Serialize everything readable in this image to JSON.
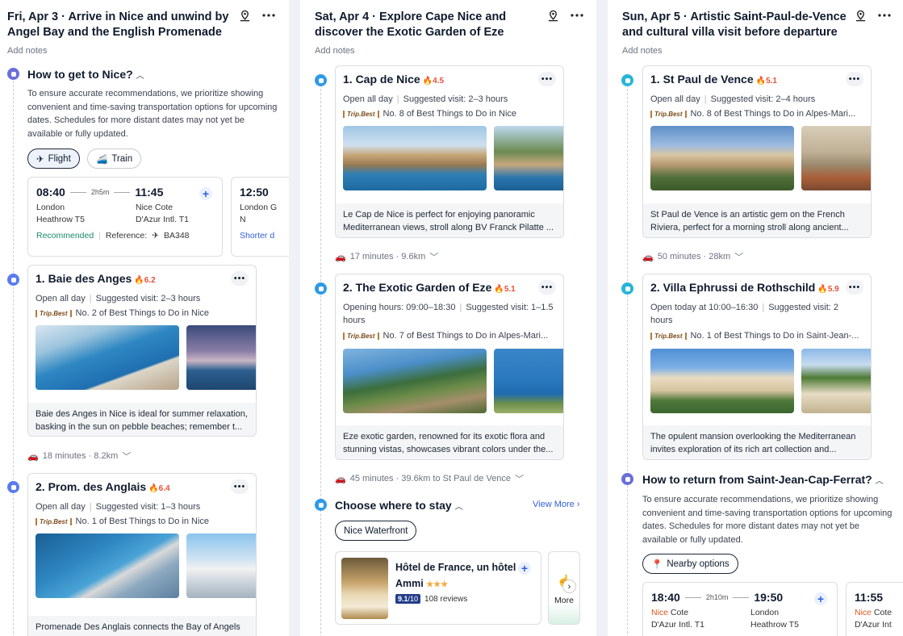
{
  "add_notes": "Add notes",
  "col1": {
    "title": "Fri, Apr 3 · Arrive in Nice and unwind by Angel Bay and the English Promenade",
    "transport": {
      "title": "How to get to Nice?",
      "description": "To ensure accurate recommendations, we prioritize showing convenient and time-saving transportation options for upcoming dates. Schedules for more distant dates may not yet be available or fully updated.",
      "tabs": [
        "Flight",
        "Train"
      ],
      "flight1": {
        "dep": "08:40",
        "duration": "2h5m",
        "arr": "11:45",
        "from_city": "London",
        "from_apt": "Heathrow T5",
        "to_city": "Nice Cote",
        "to_apt": "D'Azur Intl. T1",
        "tag": "Recommended",
        "ref": "Reference:",
        "flight_no": "BA348"
      },
      "flight2": {
        "dep": "12:50",
        "from_city": "London G",
        "from_apt": "N",
        "tag": "Shorter d"
      }
    },
    "poi1": {
      "title": "1. Baie des Anges",
      "score": "6.2",
      "hours": "Open all day",
      "visit": "Suggested visit: 2–3 hours",
      "rank_badge": "Trip.Best",
      "rank": "No. 2 of Best Things to Do in Nice",
      "desc": "Baie des Anges in Nice is ideal for summer relaxation, basking in the sun on pebble beaches; remember t..."
    },
    "travel1": "18 minutes · 8.2km",
    "poi2": {
      "title": "2. Prom. des Anglais",
      "score": "6.4",
      "hours": "Open all day",
      "visit": "Suggested visit: 1–3 hours",
      "rank_badge": "Trip.Best",
      "rank": "No. 1 of Best Things to Do in Nice",
      "desc": "Promenade Des Anglais connects the Bay of Angels with Castle Hill, ideal for shopping and savoring..."
    }
  },
  "col2": {
    "title": "Sat, Apr 4 · Explore Cape Nice and discover the Exotic Garden of Eze",
    "poi1": {
      "title": "1. Cap de Nice",
      "score": "4.5",
      "hours": "Open all day",
      "visit": "Suggested visit: 2–3 hours",
      "rank_badge": "Trip.Best",
      "rank": "No. 8 of Best Things to Do in Nice",
      "desc": "Le Cap de Nice is perfect for enjoying panoramic Mediterranean views, stroll along BV Franck Pilatte ..."
    },
    "travel1": "17 minutes · 9.6km",
    "poi2": {
      "title": "2. The Exotic Garden of Eze",
      "score": "5.1",
      "hours": "Opening hours: 09:00–18:30",
      "visit": "Suggested visit: 1–1.5",
      "visit2": "hours",
      "rank_badge": "Trip.Best",
      "rank": "No. 7 of Best Things to Do in Alpes-Mari...",
      "desc": "Eze exotic garden, renowned for its exotic flora and stunning vistas, showcases vibrant colors under the..."
    },
    "travel2": "45 minutes · 39.6km to St Paul de Vence",
    "stay": {
      "title": "Choose where to stay",
      "view_more": "View More",
      "filter": "Nice Waterfront",
      "hotel_name": "Hôtel de France, un hôtel",
      "hotel_name2": "Ammi",
      "stars": "★★★",
      "rating": "9.1",
      "rating_max": "/10",
      "reviews": "108 reviews",
      "more": "More"
    }
  },
  "col3": {
    "title": "Sun, Apr 5 · Artistic Saint-Paul-de-Vence and cultural villa visit before departure",
    "poi1": {
      "title": "1. St Paul de Vence",
      "score": "5.1",
      "hours": "Open all day",
      "visit": "Suggested visit: 2–4 hours",
      "rank_badge": "Trip.Best",
      "rank": "No. 8 of Best Things to Do in Alpes-Mari...",
      "desc": "St Paul de Vence is an artistic gem on the French Riviera, perfect for a morning stroll along ancient..."
    },
    "travel1": "50 minutes · 28km",
    "poi2": {
      "title": "2. Villa Ephrussi de Rothschild",
      "score": "5.9",
      "hours": "Open today at 10:00–16:30",
      "visit": "Suggested visit: 2",
      "visit2": "hours",
      "rank_badge": "Trip.Best",
      "rank": "No. 1 of Best Things to Do in Saint-Jean-...",
      "desc": "The opulent mansion overlooking the Mediterranean invites exploration of its rich art collection and..."
    },
    "return": {
      "title": "How to return from Saint-Jean-Cap-Ferrat?",
      "description": "To ensure accurate recommendations, we prioritize showing convenient and time-saving transportation options for upcoming dates. Schedules for more distant dates may not yet be available or fully updated.",
      "filter": "Nearby options",
      "flight1": {
        "dep": "18:40",
        "duration": "2h10m",
        "arr": "19:50",
        "from_city_hl": "Nice",
        "from_city": " Cote",
        "from_apt": "D'Azur Intl. T1",
        "to_city": "London",
        "to_apt": "Heathrow T5"
      },
      "flight2": {
        "dep": "11:55",
        "from_city_hl": "Nice",
        "from_city": " Cote",
        "from_apt": "D'Azur Int"
      }
    }
  },
  "colors": {
    "accent": "#2f5fd8",
    "score": "#e8503a",
    "recommended": "#1b8a6b"
  }
}
